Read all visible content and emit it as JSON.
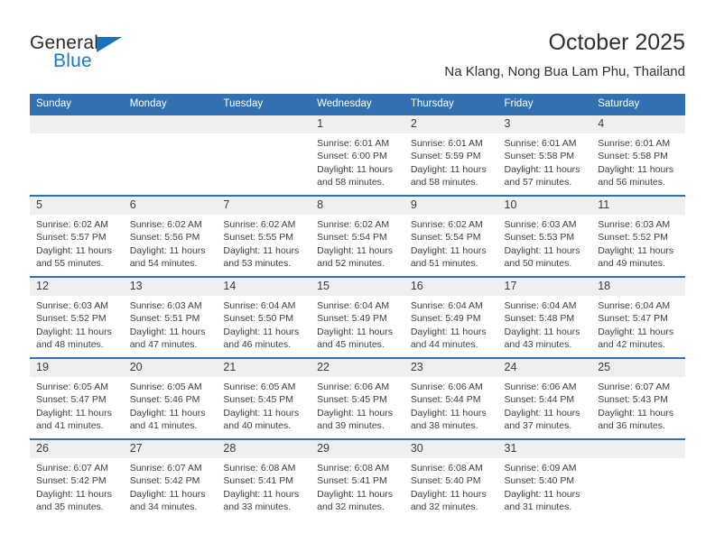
{
  "brand": {
    "name_top": "General",
    "name_bottom": "Blue",
    "triangle_icon": "triangle-right-icon",
    "accent_color": "#1b72ba",
    "text_color": "#2b2b2b"
  },
  "header": {
    "title": "October 2025",
    "subtitle": "Na Klang, Nong Bua Lam Phu, Thailand"
  },
  "calendar": {
    "header_bg": "#3171b2",
    "daynum_bg": "#efefef",
    "weekday_headers": [
      "Sunday",
      "Monday",
      "Tuesday",
      "Wednesday",
      "Thursday",
      "Friday",
      "Saturday"
    ],
    "weeks": [
      [
        {
          "day": "",
          "sunrise": "",
          "sunset": "",
          "daylight_line1": "",
          "daylight_line2": ""
        },
        {
          "day": "",
          "sunrise": "",
          "sunset": "",
          "daylight_line1": "",
          "daylight_line2": ""
        },
        {
          "day": "",
          "sunrise": "",
          "sunset": "",
          "daylight_line1": "",
          "daylight_line2": ""
        },
        {
          "day": "1",
          "sunrise": "Sunrise: 6:01 AM",
          "sunset": "Sunset: 6:00 PM",
          "daylight_line1": "Daylight: 11 hours",
          "daylight_line2": "and 58 minutes."
        },
        {
          "day": "2",
          "sunrise": "Sunrise: 6:01 AM",
          "sunset": "Sunset: 5:59 PM",
          "daylight_line1": "Daylight: 11 hours",
          "daylight_line2": "and 58 minutes."
        },
        {
          "day": "3",
          "sunrise": "Sunrise: 6:01 AM",
          "sunset": "Sunset: 5:58 PM",
          "daylight_line1": "Daylight: 11 hours",
          "daylight_line2": "and 57 minutes."
        },
        {
          "day": "4",
          "sunrise": "Sunrise: 6:01 AM",
          "sunset": "Sunset: 5:58 PM",
          "daylight_line1": "Daylight: 11 hours",
          "daylight_line2": "and 56 minutes."
        }
      ],
      [
        {
          "day": "5",
          "sunrise": "Sunrise: 6:02 AM",
          "sunset": "Sunset: 5:57 PM",
          "daylight_line1": "Daylight: 11 hours",
          "daylight_line2": "and 55 minutes."
        },
        {
          "day": "6",
          "sunrise": "Sunrise: 6:02 AM",
          "sunset": "Sunset: 5:56 PM",
          "daylight_line1": "Daylight: 11 hours",
          "daylight_line2": "and 54 minutes."
        },
        {
          "day": "7",
          "sunrise": "Sunrise: 6:02 AM",
          "sunset": "Sunset: 5:55 PM",
          "daylight_line1": "Daylight: 11 hours",
          "daylight_line2": "and 53 minutes."
        },
        {
          "day": "8",
          "sunrise": "Sunrise: 6:02 AM",
          "sunset": "Sunset: 5:54 PM",
          "daylight_line1": "Daylight: 11 hours",
          "daylight_line2": "and 52 minutes."
        },
        {
          "day": "9",
          "sunrise": "Sunrise: 6:02 AM",
          "sunset": "Sunset: 5:54 PM",
          "daylight_line1": "Daylight: 11 hours",
          "daylight_line2": "and 51 minutes."
        },
        {
          "day": "10",
          "sunrise": "Sunrise: 6:03 AM",
          "sunset": "Sunset: 5:53 PM",
          "daylight_line1": "Daylight: 11 hours",
          "daylight_line2": "and 50 minutes."
        },
        {
          "day": "11",
          "sunrise": "Sunrise: 6:03 AM",
          "sunset": "Sunset: 5:52 PM",
          "daylight_line1": "Daylight: 11 hours",
          "daylight_line2": "and 49 minutes."
        }
      ],
      [
        {
          "day": "12",
          "sunrise": "Sunrise: 6:03 AM",
          "sunset": "Sunset: 5:52 PM",
          "daylight_line1": "Daylight: 11 hours",
          "daylight_line2": "and 48 minutes."
        },
        {
          "day": "13",
          "sunrise": "Sunrise: 6:03 AM",
          "sunset": "Sunset: 5:51 PM",
          "daylight_line1": "Daylight: 11 hours",
          "daylight_line2": "and 47 minutes."
        },
        {
          "day": "14",
          "sunrise": "Sunrise: 6:04 AM",
          "sunset": "Sunset: 5:50 PM",
          "daylight_line1": "Daylight: 11 hours",
          "daylight_line2": "and 46 minutes."
        },
        {
          "day": "15",
          "sunrise": "Sunrise: 6:04 AM",
          "sunset": "Sunset: 5:49 PM",
          "daylight_line1": "Daylight: 11 hours",
          "daylight_line2": "and 45 minutes."
        },
        {
          "day": "16",
          "sunrise": "Sunrise: 6:04 AM",
          "sunset": "Sunset: 5:49 PM",
          "daylight_line1": "Daylight: 11 hours",
          "daylight_line2": "and 44 minutes."
        },
        {
          "day": "17",
          "sunrise": "Sunrise: 6:04 AM",
          "sunset": "Sunset: 5:48 PM",
          "daylight_line1": "Daylight: 11 hours",
          "daylight_line2": "and 43 minutes."
        },
        {
          "day": "18",
          "sunrise": "Sunrise: 6:04 AM",
          "sunset": "Sunset: 5:47 PM",
          "daylight_line1": "Daylight: 11 hours",
          "daylight_line2": "and 42 minutes."
        }
      ],
      [
        {
          "day": "19",
          "sunrise": "Sunrise: 6:05 AM",
          "sunset": "Sunset: 5:47 PM",
          "daylight_line1": "Daylight: 11 hours",
          "daylight_line2": "and 41 minutes."
        },
        {
          "day": "20",
          "sunrise": "Sunrise: 6:05 AM",
          "sunset": "Sunset: 5:46 PM",
          "daylight_line1": "Daylight: 11 hours",
          "daylight_line2": "and 41 minutes."
        },
        {
          "day": "21",
          "sunrise": "Sunrise: 6:05 AM",
          "sunset": "Sunset: 5:45 PM",
          "daylight_line1": "Daylight: 11 hours",
          "daylight_line2": "and 40 minutes."
        },
        {
          "day": "22",
          "sunrise": "Sunrise: 6:06 AM",
          "sunset": "Sunset: 5:45 PM",
          "daylight_line1": "Daylight: 11 hours",
          "daylight_line2": "and 39 minutes."
        },
        {
          "day": "23",
          "sunrise": "Sunrise: 6:06 AM",
          "sunset": "Sunset: 5:44 PM",
          "daylight_line1": "Daylight: 11 hours",
          "daylight_line2": "and 38 minutes."
        },
        {
          "day": "24",
          "sunrise": "Sunrise: 6:06 AM",
          "sunset": "Sunset: 5:44 PM",
          "daylight_line1": "Daylight: 11 hours",
          "daylight_line2": "and 37 minutes."
        },
        {
          "day": "25",
          "sunrise": "Sunrise: 6:07 AM",
          "sunset": "Sunset: 5:43 PM",
          "daylight_line1": "Daylight: 11 hours",
          "daylight_line2": "and 36 minutes."
        }
      ],
      [
        {
          "day": "26",
          "sunrise": "Sunrise: 6:07 AM",
          "sunset": "Sunset: 5:42 PM",
          "daylight_line1": "Daylight: 11 hours",
          "daylight_line2": "and 35 minutes."
        },
        {
          "day": "27",
          "sunrise": "Sunrise: 6:07 AM",
          "sunset": "Sunset: 5:42 PM",
          "daylight_line1": "Daylight: 11 hours",
          "daylight_line2": "and 34 minutes."
        },
        {
          "day": "28",
          "sunrise": "Sunrise: 6:08 AM",
          "sunset": "Sunset: 5:41 PM",
          "daylight_line1": "Daylight: 11 hours",
          "daylight_line2": "and 33 minutes."
        },
        {
          "day": "29",
          "sunrise": "Sunrise: 6:08 AM",
          "sunset": "Sunset: 5:41 PM",
          "daylight_line1": "Daylight: 11 hours",
          "daylight_line2": "and 32 minutes."
        },
        {
          "day": "30",
          "sunrise": "Sunrise: 6:08 AM",
          "sunset": "Sunset: 5:40 PM",
          "daylight_line1": "Daylight: 11 hours",
          "daylight_line2": "and 32 minutes."
        },
        {
          "day": "31",
          "sunrise": "Sunrise: 6:09 AM",
          "sunset": "Sunset: 5:40 PM",
          "daylight_line1": "Daylight: 11 hours",
          "daylight_line2": "and 31 minutes."
        },
        {
          "day": "",
          "sunrise": "",
          "sunset": "",
          "daylight_line1": "",
          "daylight_line2": ""
        }
      ]
    ]
  }
}
